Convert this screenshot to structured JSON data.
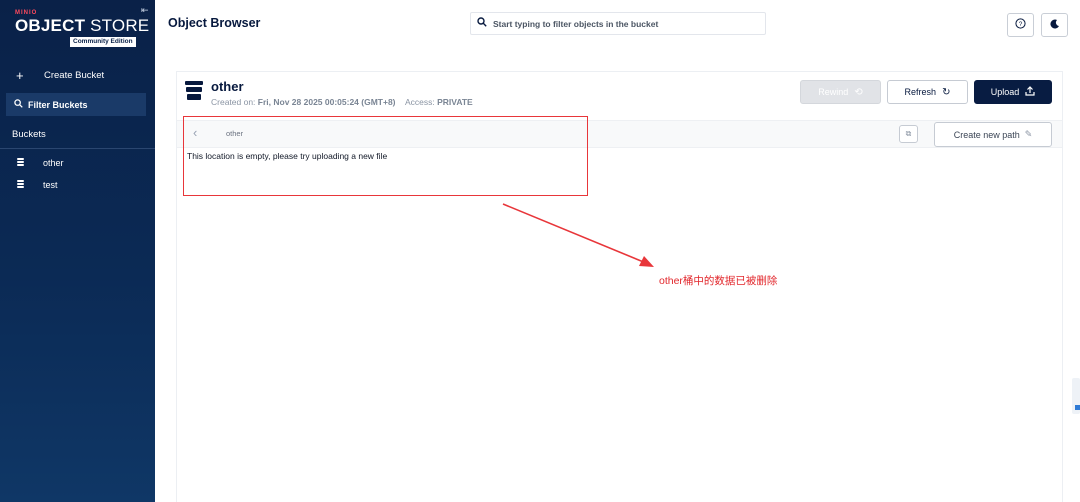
{
  "brand": {
    "small": "MINIO",
    "name_bold": "OBJECT",
    "name_rest": " STORE",
    "edition": "Community Edition"
  },
  "sidebar": {
    "create_bucket": "Create Bucket",
    "filter_buckets": "Filter Buckets",
    "buckets_title": "Buckets",
    "buckets": [
      {
        "label": "other"
      },
      {
        "label": "test"
      }
    ]
  },
  "header": {
    "title": "Object Browser",
    "search_placeholder": "Start typing to filter objects in the bucket"
  },
  "bucket": {
    "name": "other",
    "created_label": "Created on:",
    "created_value": "Fri, Nov 28 2025 00:05:24 (GMT+8)",
    "access_label": "Access:",
    "access_value": "PRIVATE"
  },
  "actions": {
    "rewind": "Rewind",
    "refresh": "Refresh",
    "upload": "Upload",
    "create_new_path": "Create new path"
  },
  "path": {
    "current": "other"
  },
  "empty_message": "This location is empty, please try uploading a new file",
  "annotation": {
    "text": "other桶中的数据已被删除",
    "color": "#e2262b"
  },
  "colors": {
    "sidebar_bg": "#0a2148",
    "primary": "#081c42",
    "annotation_red": "#e8363a"
  }
}
